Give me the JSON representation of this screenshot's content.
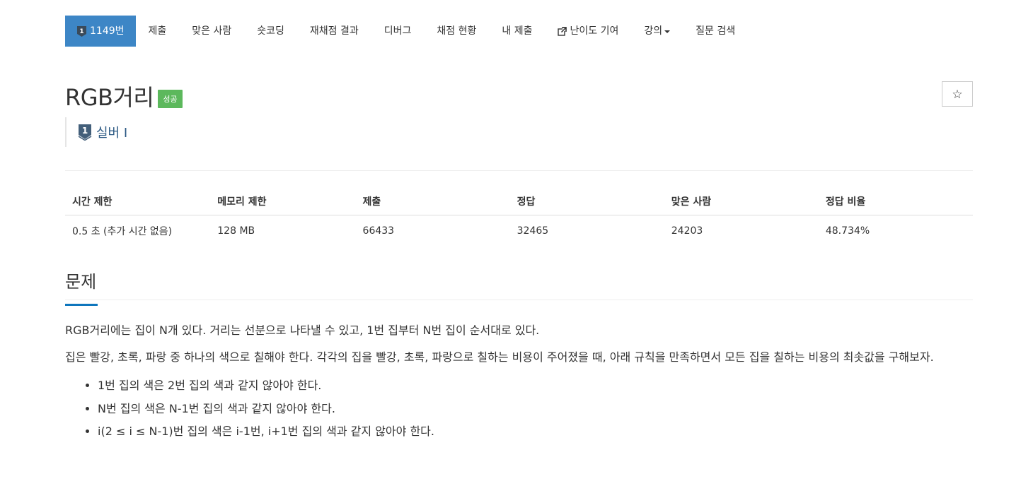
{
  "nav": {
    "problem_id": "1149번",
    "items": [
      "제출",
      "맞은 사람",
      "숏코딩",
      "재채점 결과",
      "디버그",
      "채점 현황",
      "내 제출"
    ],
    "contribute": "난이도 기여",
    "lecture": "강의",
    "qna": "질문 검색",
    "active_color": "#3d86c6"
  },
  "problem": {
    "title": "RGB거리",
    "status_label": "성공",
    "tier_number": "1",
    "tier": "실버 I",
    "star_icon": "star-outline"
  },
  "info_table": {
    "headers": [
      "시간 제한",
      "메모리 제한",
      "제출",
      "정답",
      "맞은 사람",
      "정답 비율"
    ],
    "row": [
      "0.5 초 (추가 시간 없음)",
      "128 MB",
      "66433",
      "32465",
      "24203",
      "48.734%"
    ]
  },
  "section": {
    "title": "문제",
    "para1": "RGB거리에는 집이 N개 있다. 거리는 선분으로 나타낼 수 있고, 1번 집부터 N번 집이 순서대로 있다.",
    "para2": "집은 빨강, 초록, 파랑 중 하나의 색으로 칠해야 한다. 각각의 집을 빨강, 초록, 파랑으로 칠하는 비용이 주어졌을 때, 아래 규칙을 만족하면서 모든 집을 칠하는 비용의 최솟값을 구해보자.",
    "rules": [
      "1번 집의 색은 2번 집의 색과 같지 않아야 한다.",
      "N번 집의 색은 N-1번 집의 색과 같지 않아야 한다.",
      "i(2 ≤ i ≤ N-1)번 집의 색은 i-1번, i+1번 집의 색과 같지 않아야 한다."
    ]
  },
  "colors": {
    "success": "#5cb85c",
    "tier_silver": "#435f7a",
    "accent_underline": "#0e76bd"
  }
}
